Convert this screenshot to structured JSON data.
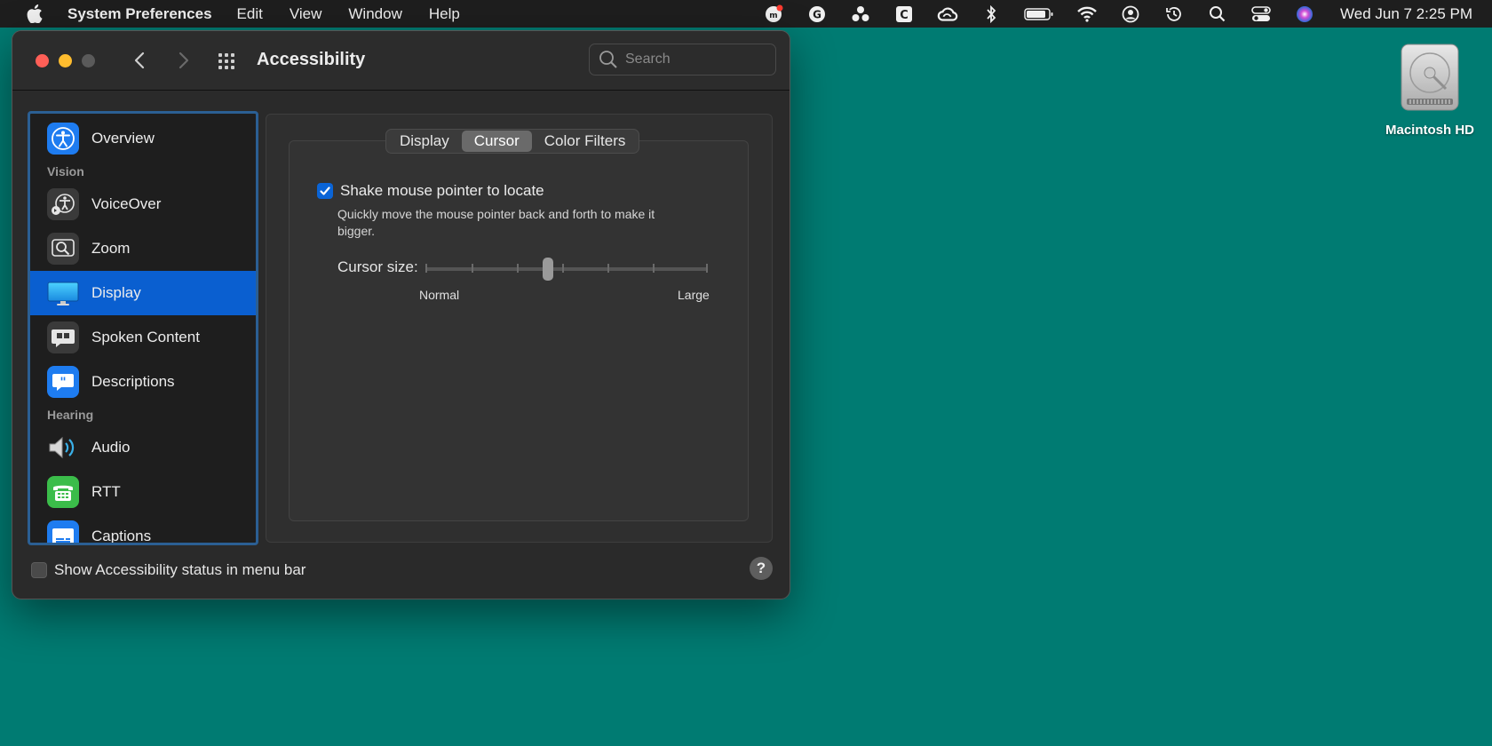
{
  "menubar": {
    "app_name": "System Preferences",
    "menus": [
      "Edit",
      "View",
      "Window",
      "Help"
    ],
    "clock": "Wed Jun 7  2:25 PM",
    "status_icons": [
      "mail-badge-icon",
      "grammarly-icon",
      "dots-icon",
      "c-app-icon",
      "creative-cloud-icon",
      "bluetooth-icon",
      "battery-icon",
      "wifi-icon",
      "user-icon",
      "time-machine-icon",
      "spotlight-icon",
      "control-center-icon",
      "siri-icon"
    ]
  },
  "window": {
    "title": "Accessibility",
    "search_placeholder": "Search"
  },
  "sidebar": {
    "items": [
      {
        "label": "Overview",
        "icon": "accessibility-icon",
        "color": "#1e7cf0"
      },
      {
        "label": "VoiceOver",
        "icon": "voiceover-icon",
        "color": "#3a3a3a"
      },
      {
        "label": "Zoom",
        "icon": "zoom-icon",
        "color": "#3a3a3a"
      },
      {
        "label": "Display",
        "icon": "display-icon",
        "color": "#1aa3e8"
      },
      {
        "label": "Spoken Content",
        "icon": "spoken-content-icon",
        "color": "#3a3a3a"
      },
      {
        "label": "Descriptions",
        "icon": "descriptions-icon",
        "color": "#1e7cf0"
      },
      {
        "label": "Audio",
        "icon": "speaker-icon",
        "color": "#3a3a3a"
      },
      {
        "label": "RTT",
        "icon": "rtt-icon",
        "color": "#3bbd4a"
      },
      {
        "label": "Captions",
        "icon": "captions-icon",
        "color": "#1e7cf0"
      }
    ],
    "headers": {
      "vision": "Vision",
      "hearing": "Hearing"
    },
    "selected": "Display"
  },
  "tabs": {
    "items": [
      "Display",
      "Cursor",
      "Color Filters"
    ],
    "active": "Cursor"
  },
  "cursor": {
    "shake_label": "Shake mouse pointer to locate",
    "shake_checked": true,
    "shake_desc": "Quickly move the mouse pointer back and forth to make it bigger.",
    "size_label": "Cursor size:",
    "size_min": "Normal",
    "size_max": "Large",
    "size_value": 0.43
  },
  "footer": {
    "status_label": "Show Accessibility status in menu bar",
    "status_checked": false,
    "help": "?"
  },
  "desktop": {
    "icon_label": "Macintosh HD"
  },
  "colors": {
    "desktop": "#007b72",
    "accent": "#0a5fd0",
    "sidebar_focus": "#2b5f93"
  }
}
